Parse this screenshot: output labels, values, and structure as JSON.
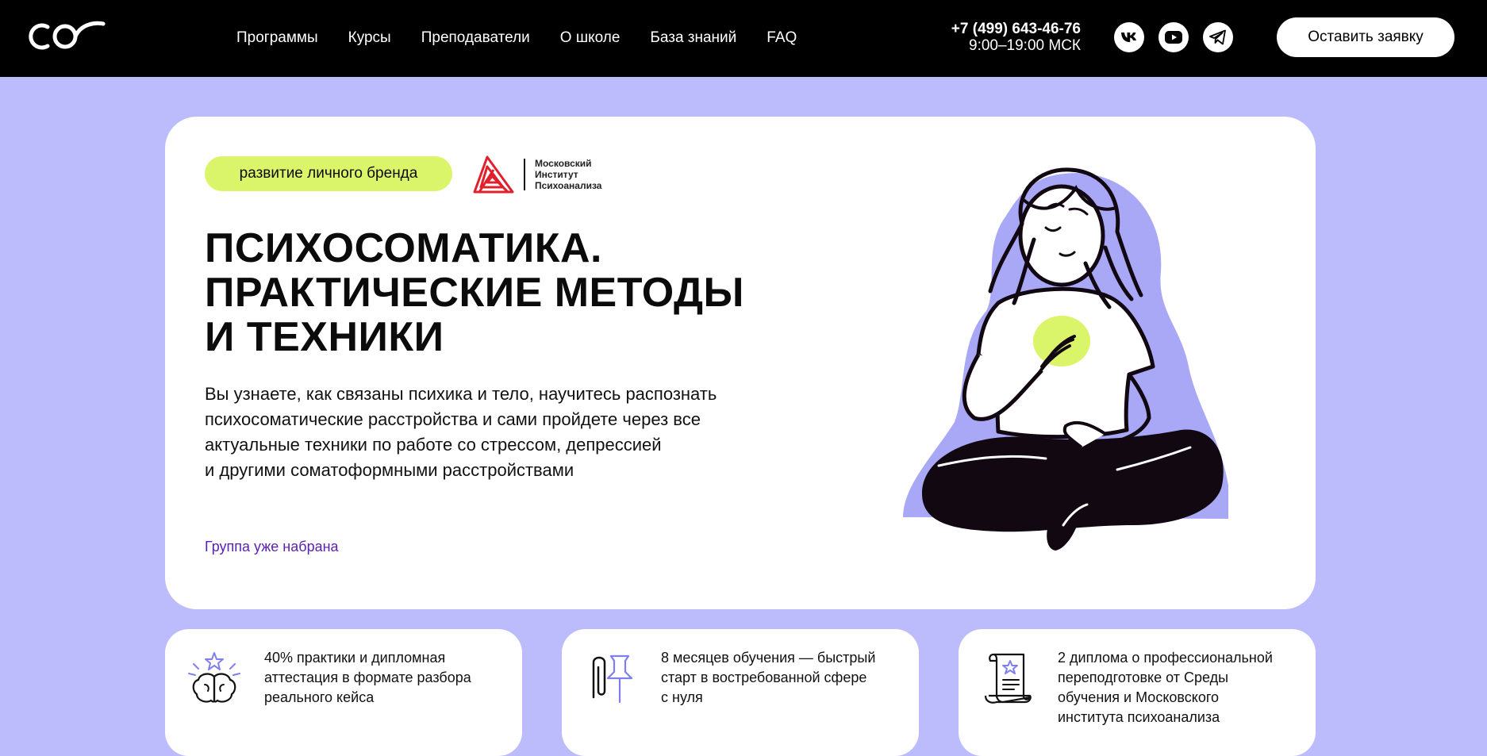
{
  "header": {
    "nav": [
      "Программы",
      "Курсы",
      "Преподаватели",
      "О школе",
      "База знаний",
      "FAQ"
    ],
    "phone": "+7 (499) 643-46-76",
    "hours": "9:00–19:00 МСК",
    "socials": [
      "vk-icon",
      "youtube-icon",
      "telegram-icon"
    ],
    "cta": "Оставить заявку"
  },
  "hero": {
    "tag": "развитие личного бренда",
    "partner_lines": [
      "Московский",
      "Институт",
      "Психоанализа"
    ],
    "title_lines": [
      "ПСИХОСОМАТИКА.",
      "ПРАКТИЧЕСКИЕ МЕТОДЫ",
      "И ТЕХНИКИ"
    ],
    "description_lines": [
      "Вы узнаете, как связаны психика и тело, научитесь распознать",
      "психосоматические расстройства и сами пройдете через все",
      "актуальные техники по работе со стрессом, депрессией",
      "и другими соматоформными расстройствами"
    ],
    "status": "Группа уже набрана"
  },
  "features": [
    {
      "icon": "brain-star-icon",
      "lines": [
        "40% практики и дипломная",
        "аттестация в формате разбора",
        "реального кейса"
      ]
    },
    {
      "icon": "paperclip-pin-icon",
      "lines": [
        "8 месяцев обучения — быстрый",
        "старт в востребованной сфере",
        "с нуля"
      ]
    },
    {
      "icon": "diploma-scroll-icon",
      "lines": [
        "2 диплома о профессиональной",
        "переподготовке от Среды",
        "обучения и Московского",
        "института психоанализа"
      ]
    }
  ],
  "colors": {
    "background": "#bcbcfc",
    "header": "#000000",
    "tag": "#daf56a",
    "status": "#5a1fb0",
    "partner_logo": "#e0202a"
  }
}
